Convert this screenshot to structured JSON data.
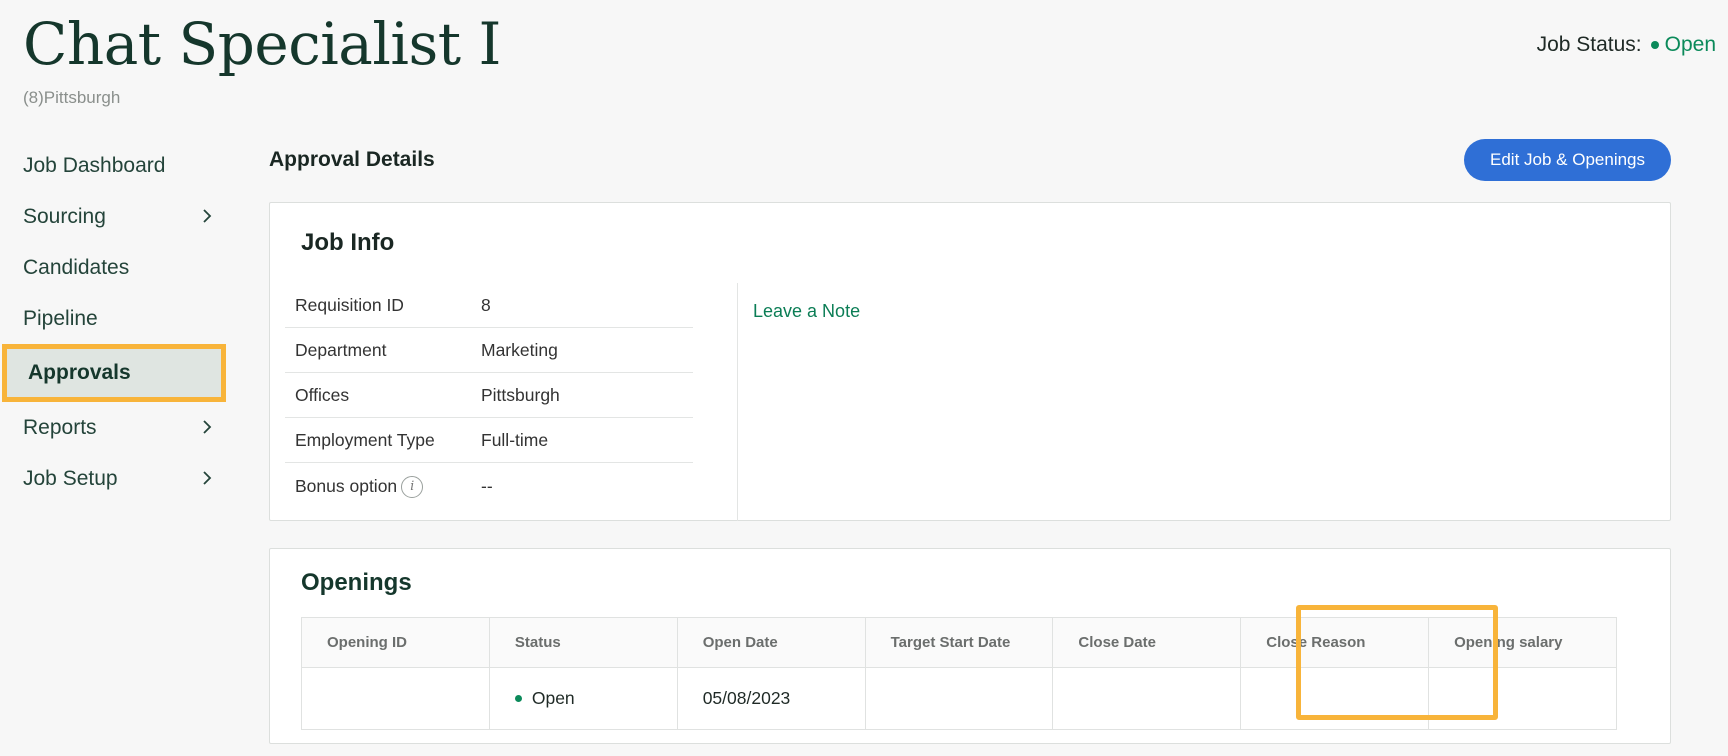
{
  "header": {
    "title": "Chat Specialist I",
    "subtitle": "(8)Pittsburgh",
    "status_label": "Job Status:",
    "status_value": "Open"
  },
  "sidebar": {
    "items": [
      {
        "label": "Job Dashboard",
        "has_chevron": false
      },
      {
        "label": "Sourcing",
        "has_chevron": true
      },
      {
        "label": "Candidates",
        "has_chevron": false
      },
      {
        "label": "Pipeline",
        "has_chevron": false
      },
      {
        "label": "Approvals",
        "has_chevron": false,
        "active": true
      },
      {
        "label": "Reports",
        "has_chevron": true
      },
      {
        "label": "Job Setup",
        "has_chevron": true
      }
    ]
  },
  "main": {
    "section_title": "Approval Details",
    "edit_button": "Edit Job & Openings",
    "job_info": {
      "title": "Job Info",
      "rows": [
        {
          "key": "Requisition ID",
          "value": "8"
        },
        {
          "key": "Department",
          "value": "Marketing"
        },
        {
          "key": "Offices",
          "value": "Pittsburgh"
        },
        {
          "key": "Employment Type",
          "value": "Full-time"
        },
        {
          "key": "Bonus option",
          "value": "--"
        }
      ],
      "info_icon_glyph": "i",
      "leave_note": "Leave a Note"
    },
    "openings": {
      "title": "Openings",
      "columns": [
        "Opening ID",
        "Status",
        "Open Date",
        "Target Start Date",
        "Close Date",
        "Close Reason",
        "Opening salary"
      ],
      "rows": [
        {
          "opening_id": "",
          "status": "Open",
          "open_date": "05/08/2023",
          "target_start": "",
          "close_date": "",
          "close_reason": "",
          "salary": ""
        }
      ]
    }
  },
  "colors": {
    "accent_green": "#0b8a5a",
    "button_blue": "#2f6fd6",
    "highlight": "#f8b43a"
  }
}
